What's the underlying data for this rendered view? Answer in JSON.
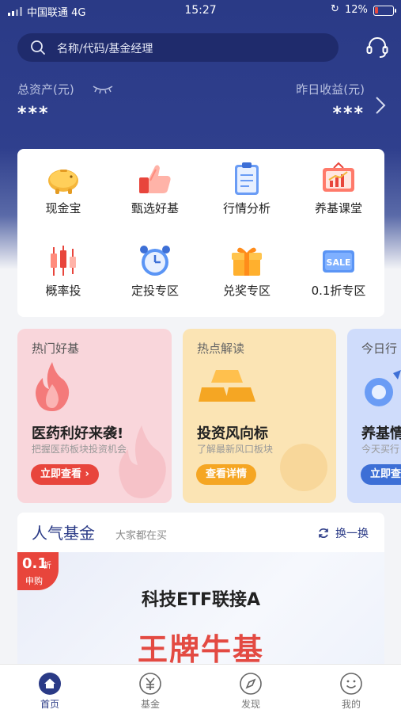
{
  "status_bar": {
    "carrier": "中国联通 4G",
    "time": "15:27",
    "battery": "12%"
  },
  "search": {
    "placeholder": "名称/代码/基金经理"
  },
  "assets": {
    "total_label": "总资产(元)",
    "total_value": "***",
    "yesterday_label": "昨日收益(元)",
    "yesterday_value": "***"
  },
  "menu": [
    {
      "label": "现金宝",
      "icon": "piggy-bank-icon"
    },
    {
      "label": "甄选好基",
      "icon": "thumbs-up-icon"
    },
    {
      "label": "行情分析",
      "icon": "clipboard-icon"
    },
    {
      "label": "养基课堂",
      "icon": "chart-board-icon"
    },
    {
      "label": "概率投",
      "icon": "candlestick-icon"
    },
    {
      "label": "定投专区",
      "icon": "alarm-clock-icon"
    },
    {
      "label": "兑奖专区",
      "icon": "gift-icon"
    },
    {
      "label": "0.1折专区",
      "icon": "sale-tag-icon"
    }
  ],
  "promos": [
    {
      "tag": "热门好基",
      "title": "医药利好来袭!",
      "subtitle": "把握医药板块投资机会",
      "button": "立即查看 ›",
      "icon": "flame-icon"
    },
    {
      "tag": "热点解读",
      "title": "投资风向标",
      "subtitle": "了解最新风口板块",
      "button": "查看详情",
      "icon": "gold-bars-icon"
    },
    {
      "tag": "今日行",
      "title": "养基情",
      "subtitle": "今天买行",
      "button": "立即查",
      "icon": "rocket-icon"
    }
  ],
  "popular": {
    "title": "人气基金",
    "subtitle": "大家都在买",
    "refresh": "换一换",
    "ribbon_main": "0.1",
    "ribbon_unit": "折",
    "ribbon_sub": "申购",
    "fund_name": "科技ETF联接A",
    "fund_tagline": "王牌牛基"
  },
  "tabbar": [
    {
      "label": "首页",
      "icon": "home-icon",
      "active": true
    },
    {
      "label": "基金",
      "icon": "yen-coin-icon",
      "active": false
    },
    {
      "label": "发现",
      "icon": "compass-icon",
      "active": false
    },
    {
      "label": "我的",
      "icon": "smiley-icon",
      "active": false
    }
  ]
}
